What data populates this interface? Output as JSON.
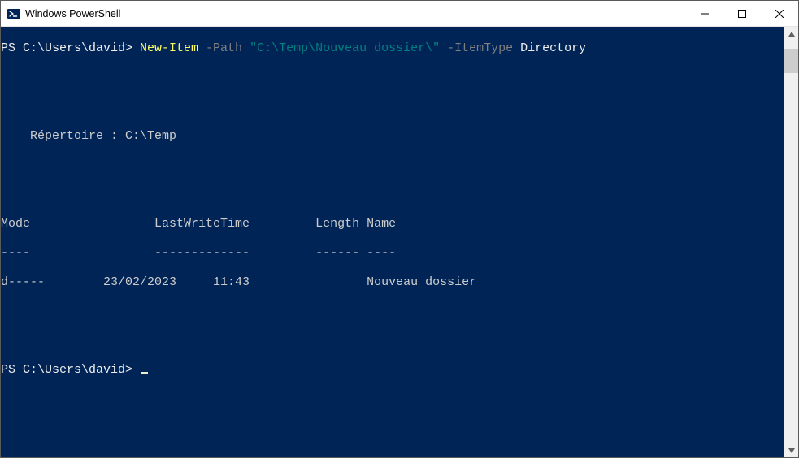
{
  "window": {
    "title": "Windows PowerShell"
  },
  "command": {
    "prompt": "PS C:\\Users\\david> ",
    "cmdlet": "New-Item",
    "param_path_name": " -Path ",
    "param_path_value": "\"C:\\Temp\\Nouveau dossier\\\"",
    "param_type_name": " -ItemType ",
    "param_type_value": "Directory"
  },
  "output": {
    "directory_line": "    Répertoire : C:\\Temp",
    "header": "Mode                 LastWriteTime         Length Name",
    "separator": "----                 -------------         ------ ----",
    "row": "d-----        23/02/2023     11:43                Nouveau dossier"
  },
  "next_prompt": "PS C:\\Users\\david> "
}
